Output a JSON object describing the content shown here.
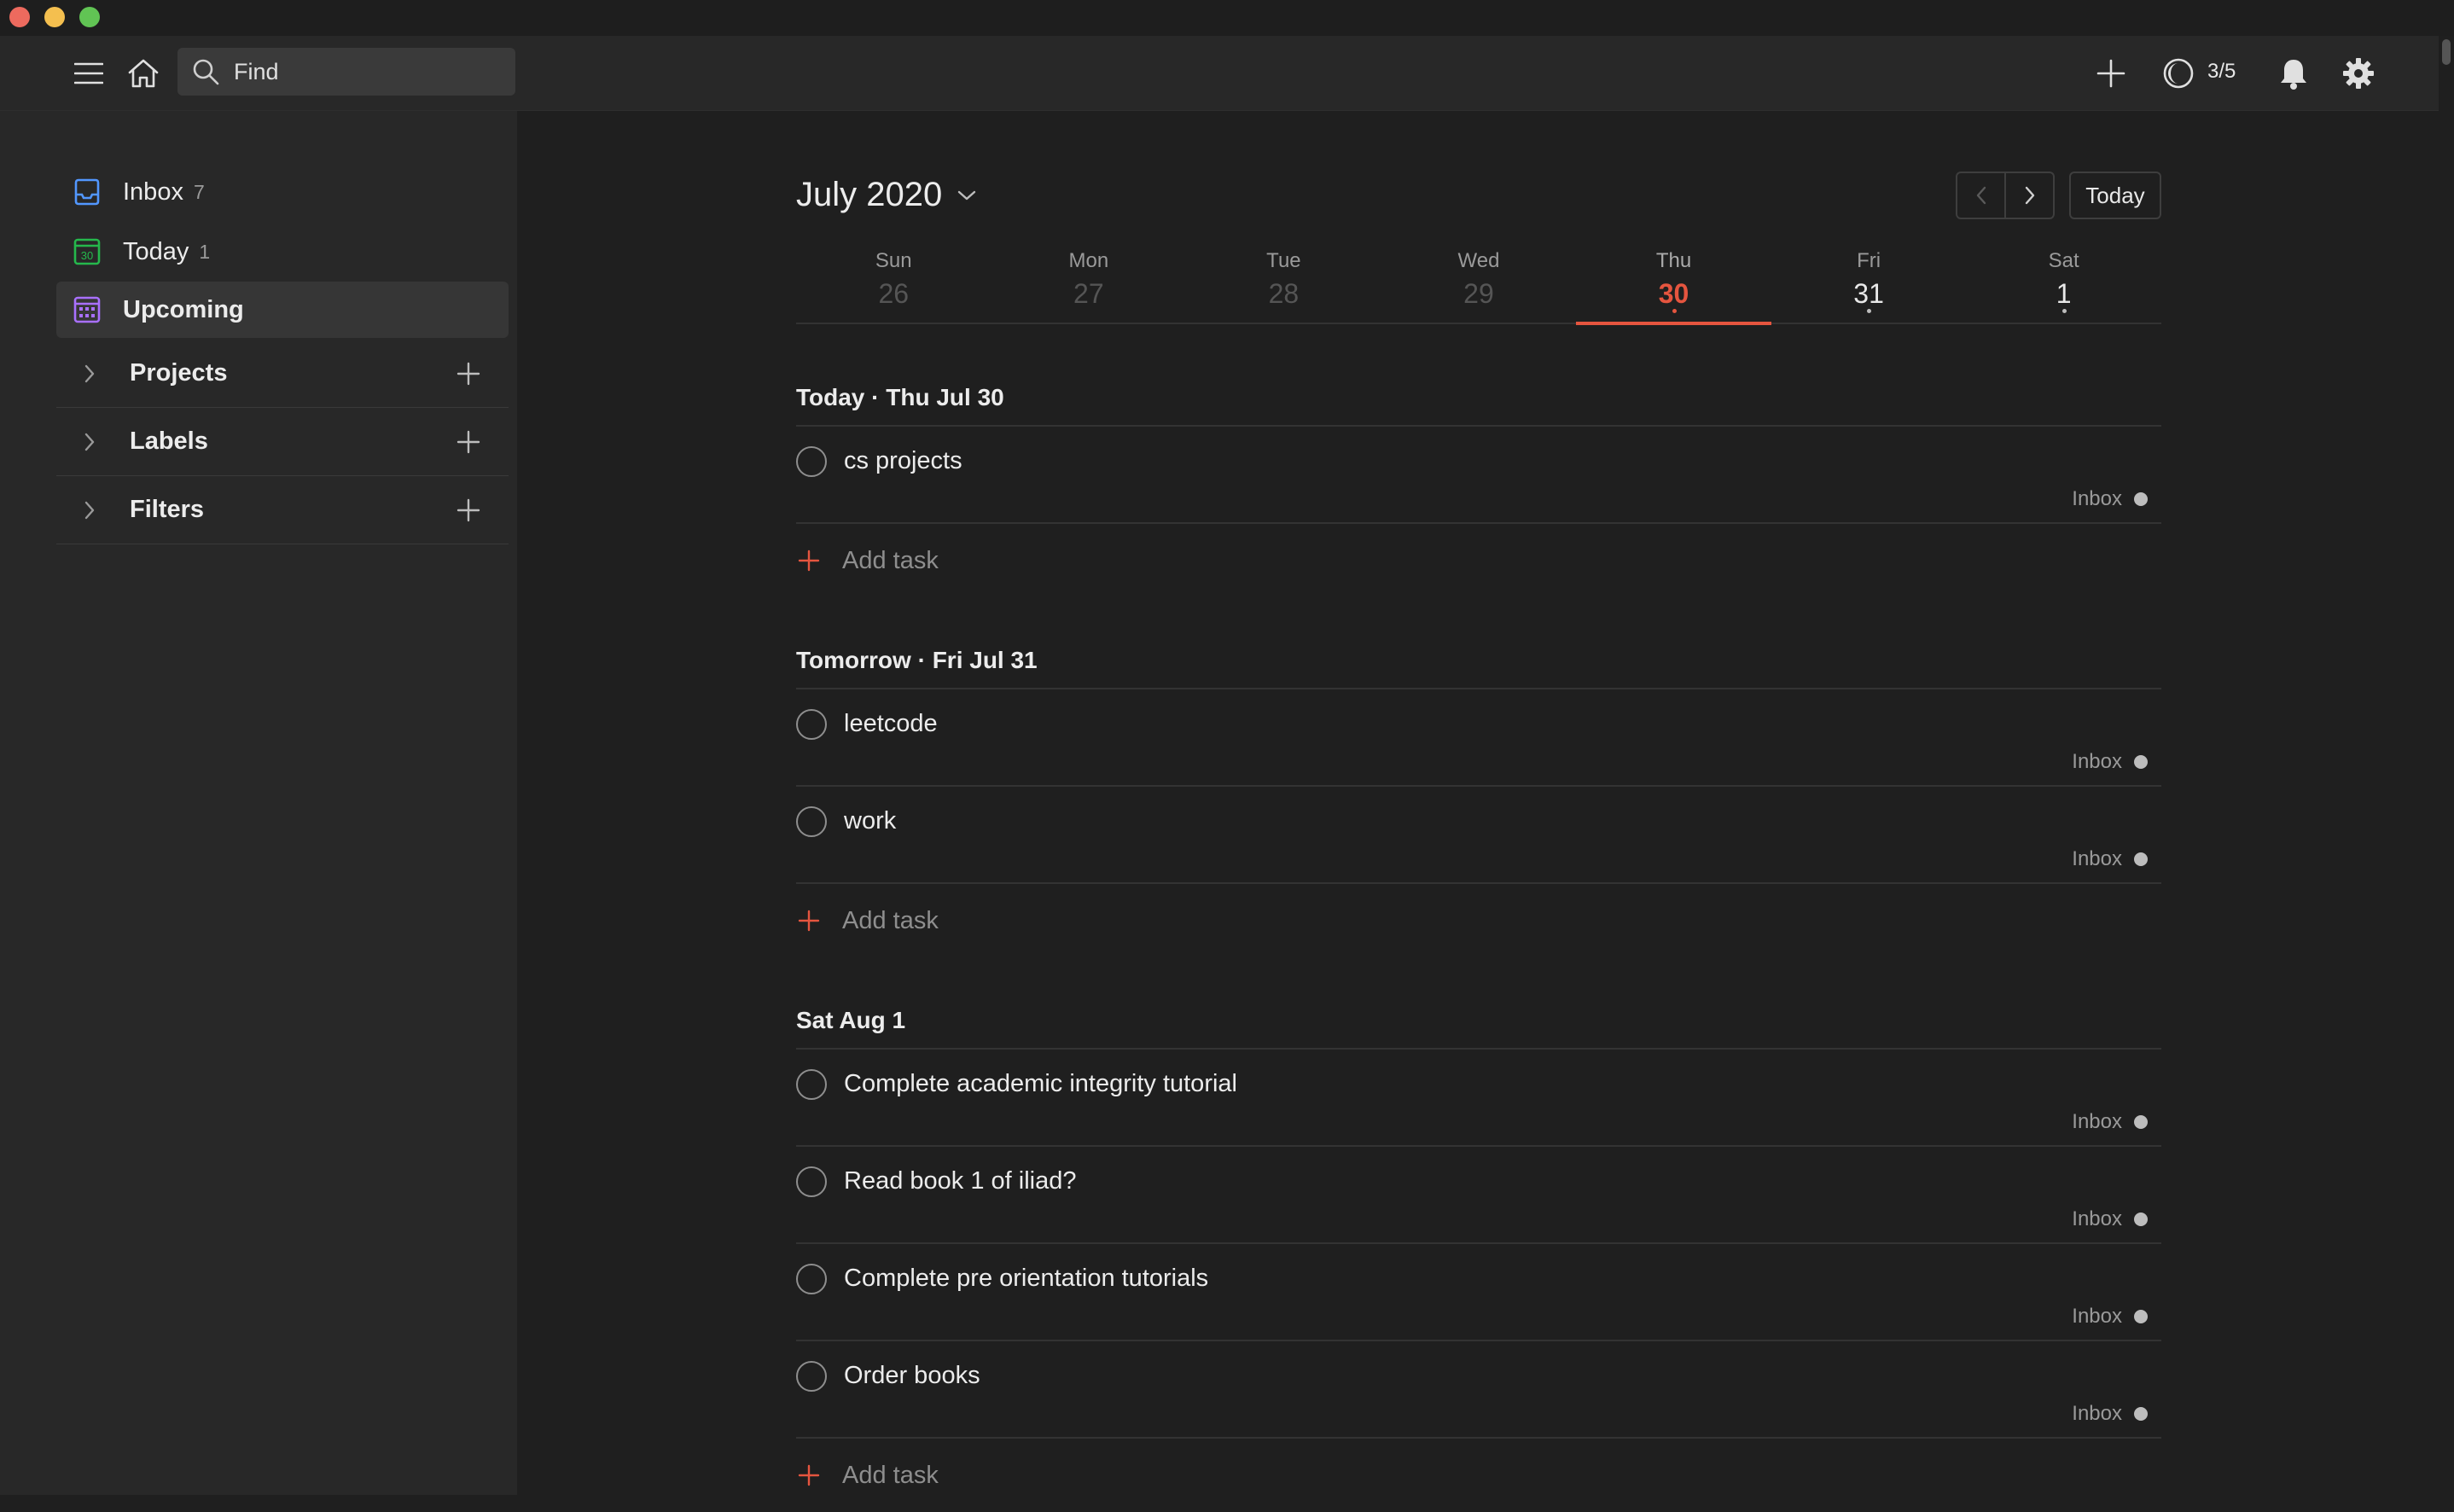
{
  "window": {
    "controls": [
      "close",
      "minimize",
      "zoom"
    ]
  },
  "topbar": {
    "search_placeholder": "Find",
    "karma": "3/5",
    "icons": [
      "menu-icon",
      "home-icon",
      "search-icon",
      "add-icon",
      "karma-icon",
      "bell-icon",
      "gear-icon"
    ]
  },
  "sidebar": {
    "items": [
      {
        "label": "Inbox",
        "count": "7",
        "icon": "inbox-icon",
        "color": "#5297ff"
      },
      {
        "label": "Today",
        "count": "1",
        "icon": "calendar-today-icon",
        "color": "#25b84c",
        "icon_text": "30"
      },
      {
        "label": "Upcoming",
        "count": "",
        "icon": "calendar-upcoming-icon",
        "color": "#a970ff",
        "active": true
      }
    ],
    "sections": [
      {
        "label": "Projects"
      },
      {
        "label": "Labels"
      },
      {
        "label": "Filters"
      }
    ]
  },
  "main": {
    "month": "July 2020",
    "today_button": "Today",
    "week": [
      {
        "name": "Sun",
        "num": "26",
        "state": "past"
      },
      {
        "name": "Mon",
        "num": "27",
        "state": "past"
      },
      {
        "name": "Tue",
        "num": "28",
        "state": "past"
      },
      {
        "name": "Wed",
        "num": "29",
        "state": "past"
      },
      {
        "name": "Thu",
        "num": "30",
        "state": "current",
        "has_tasks": true
      },
      {
        "name": "Fri",
        "num": "31",
        "state": "future",
        "has_tasks": true
      },
      {
        "name": "Sat",
        "num": "1",
        "state": "future",
        "has_tasks": true
      }
    ],
    "groups": [
      {
        "header": "Today · Thu Jul 30",
        "tasks": [
          {
            "name": "cs projects",
            "project": "Inbox"
          }
        ],
        "add_label": "Add task"
      },
      {
        "header": "Tomorrow · Fri Jul 31",
        "tasks": [
          {
            "name": "leetcode",
            "project": "Inbox"
          },
          {
            "name": "work",
            "project": "Inbox"
          }
        ],
        "add_label": "Add task"
      },
      {
        "header": "Sat Aug 1",
        "tasks": [
          {
            "name": "Complete academic integrity tutorial",
            "project": "Inbox"
          },
          {
            "name": "Read book 1 of iliad?",
            "project": "Inbox"
          },
          {
            "name": "Complete pre orientation tutorials",
            "project": "Inbox"
          },
          {
            "name": "Order books",
            "project": "Inbox"
          }
        ],
        "add_label": "Add task"
      }
    ]
  },
  "colors": {
    "accent": "#e5553f",
    "background": "#1f1f1f",
    "panel": "#282828"
  }
}
